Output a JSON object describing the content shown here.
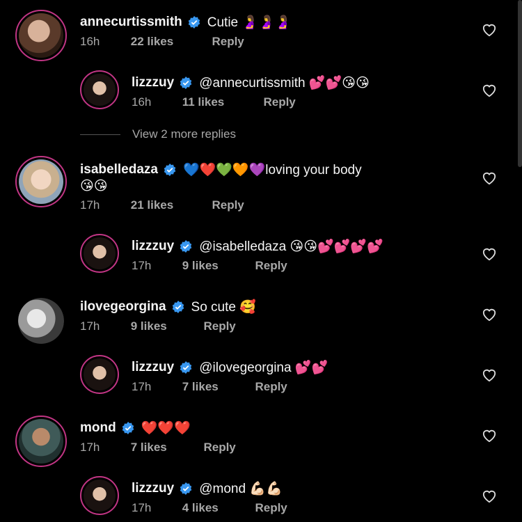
{
  "comments": [
    {
      "username": "annecurtissmith",
      "text": "Cutie 🤰🤰🤰",
      "time": "16h",
      "likes": "22 likes",
      "reply": "Reply"
    },
    {
      "username": "lizzzuy",
      "text": "@annecurtissmith 💕💕😘😘",
      "time": "16h",
      "likes": "11 likes",
      "reply": "Reply"
    },
    {
      "username": "isabelledaza",
      "text": "💙❤️💚🧡💜loving your body",
      "text_cont": "😘😘",
      "time": "17h",
      "likes": "21 likes",
      "reply": "Reply"
    },
    {
      "username": "lizzzuy",
      "text": "@isabelledaza 😘😘💕💕💕💕",
      "time": "17h",
      "likes": "9 likes",
      "reply": "Reply"
    },
    {
      "username": "ilovegeorgina",
      "text": "So cute 🥰",
      "time": "17h",
      "likes": "9 likes",
      "reply": "Reply"
    },
    {
      "username": "lizzzuy",
      "text": "@ilovegeorgina 💕💕",
      "time": "17h",
      "likes": "7 likes",
      "reply": "Reply"
    },
    {
      "username": "mond",
      "text": "❤️❤️❤️",
      "time": "17h",
      "likes": "7 likes",
      "reply": "Reply"
    },
    {
      "username": "lizzzuy",
      "text": "@mond 💪🏻💪🏻",
      "time": "17h",
      "likes": "4 likes",
      "reply": "Reply"
    }
  ],
  "view_more": "View 2 more replies",
  "colors": {
    "verified": "#3897f0",
    "ring": "#c13584",
    "meta": "#a8a8a8"
  },
  "icons": {
    "verified": "verified-badge-icon",
    "like": "heart-outline-icon"
  }
}
